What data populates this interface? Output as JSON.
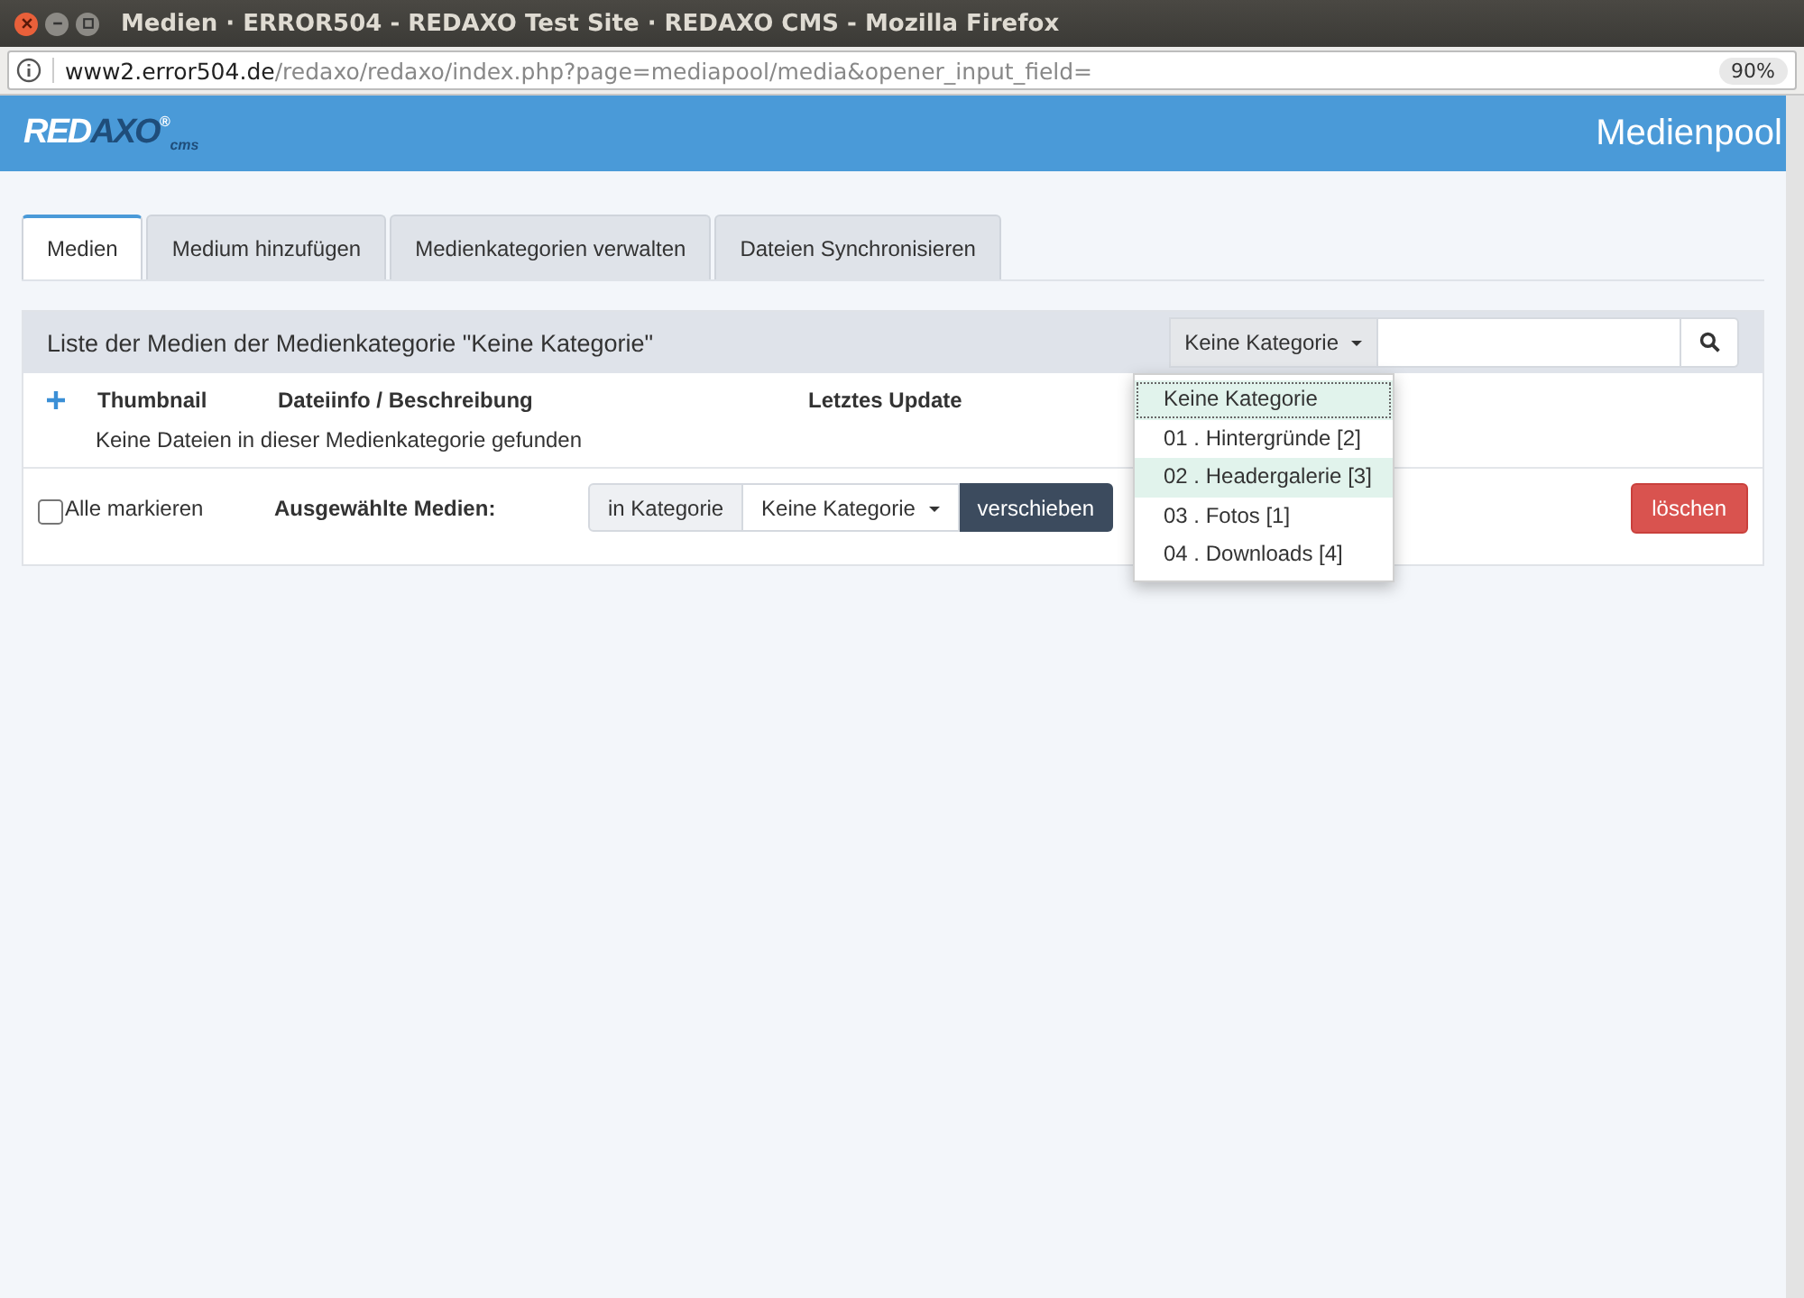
{
  "window": {
    "title": "Medien · ERROR504 - REDAXO Test Site · REDAXO CMS - Mozilla Firefox"
  },
  "address_bar": {
    "host": "www2.error504.de",
    "path": "/redaxo/redaxo/index.php?page=mediapool/media&opener_input_field=",
    "zoom": "90%"
  },
  "header": {
    "logo_main": "RED",
    "logo_accent": "AXO",
    "logo_mark": "®",
    "logo_sub": "cms",
    "title": "Medienpool"
  },
  "tabs": [
    {
      "label": "Medien",
      "selected": true
    },
    {
      "label": "Medium hinzufügen",
      "selected": false
    },
    {
      "label": "Medienkategorien verwalten",
      "selected": false
    },
    {
      "label": "Dateien Synchronisieren",
      "selected": false
    }
  ],
  "panel": {
    "title": "Liste der Medien der Medienkategorie \"Keine Kategorie\"",
    "category_select": "Keine Kategorie",
    "columns": [
      "Thumbnail",
      "Dateiinfo / Beschreibung",
      "Letztes Update"
    ],
    "empty_message": "Keine Dateien in dieser Medienkategorie gefunden",
    "select_all": {
      "label": "Alle markieren",
      "checked": false
    },
    "selected_label": "Ausgewählte Medien:",
    "move_prefix": "in Kategorie",
    "move_select": "Keine Kategorie",
    "move_button": "verschieben",
    "delete_button": "löschen"
  },
  "dropdown": [
    {
      "label": "Keine Kategorie",
      "selected": true,
      "highlighted": false
    },
    {
      "label": "01 . Hintergründe [2]",
      "selected": false,
      "highlighted": false
    },
    {
      "label": "02 . Headergalerie [3]",
      "selected": false,
      "highlighted": true
    },
    {
      "label": "03 . Fotos [1]",
      "selected": false,
      "highlighted": false
    },
    {
      "label": "04 . Downloads [4]",
      "selected": false,
      "highlighted": false
    }
  ]
}
